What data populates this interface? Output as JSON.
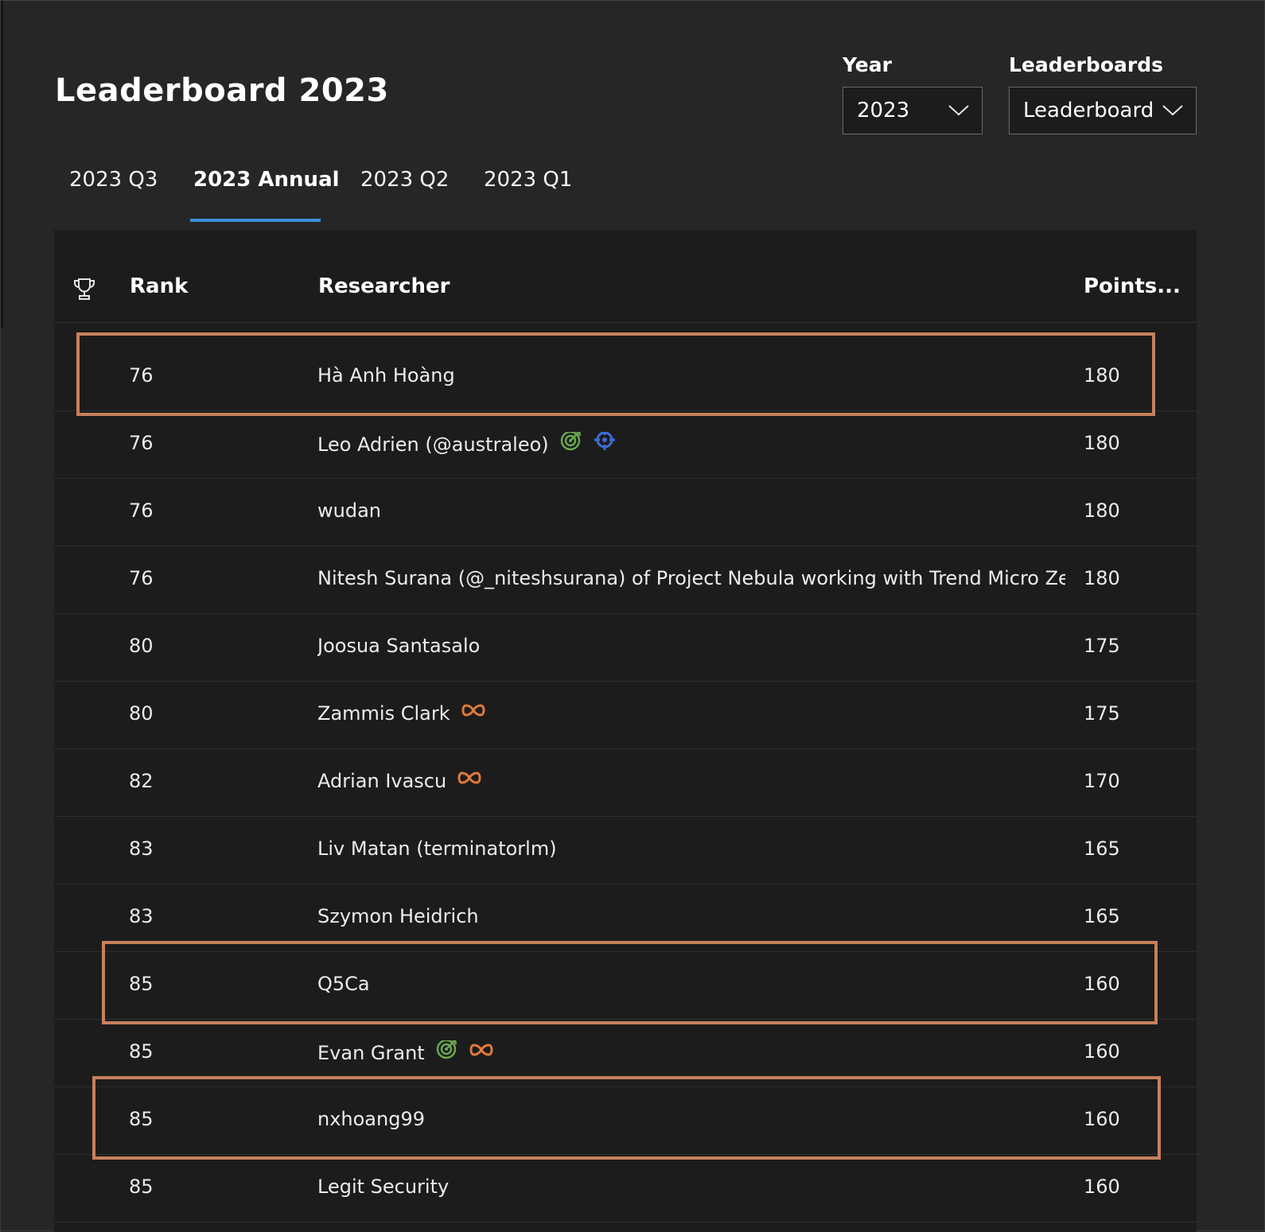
{
  "page": {
    "title": "Leaderboard 2023"
  },
  "filters": {
    "year": {
      "label": "Year",
      "value": "2023"
    },
    "leaderboards": {
      "label": "Leaderboards",
      "value": "Leaderboard"
    }
  },
  "tabs": [
    {
      "label": "2023 Q3",
      "active": false
    },
    {
      "label": "2023 Annual",
      "active": true
    },
    {
      "label": "2023 Q2",
      "active": false
    },
    {
      "label": "2023 Q1",
      "active": false
    }
  ],
  "table": {
    "headers": {
      "rank": "Rank",
      "researcher": "Researcher",
      "points": "Points..."
    },
    "rows": [
      {
        "rank": "76",
        "researcher": "Hà Anh Hoàng",
        "points": "180",
        "badges": [],
        "highlighted": true
      },
      {
        "rank": "76",
        "researcher": "Leo Adrien (@australeo)",
        "points": "180",
        "badges": [
          "target-icon",
          "crosshair-icon"
        ],
        "highlighted": false
      },
      {
        "rank": "76",
        "researcher": "wudan",
        "points": "180",
        "badges": [],
        "highlighted": false
      },
      {
        "rank": "76",
        "researcher": "Nitesh Surana (@_niteshsurana) of Project Nebula working with Trend Micro Zero Day Initi",
        "points": "180",
        "badges": [],
        "highlighted": false
      },
      {
        "rank": "80",
        "researcher": "Joosua Santasalo",
        "points": "175",
        "badges": [],
        "highlighted": false
      },
      {
        "rank": "80",
        "researcher": "Zammis Clark",
        "points": "175",
        "badges": [
          "infinity-icon"
        ],
        "highlighted": false
      },
      {
        "rank": "82",
        "researcher": "Adrian Ivascu",
        "points": "170",
        "badges": [
          "infinity-icon"
        ],
        "highlighted": false
      },
      {
        "rank": "83",
        "researcher": "Liv Matan (terminatorlm)",
        "points": "165",
        "badges": [],
        "highlighted": false
      },
      {
        "rank": "83",
        "researcher": "Szymon Heidrich",
        "points": "165",
        "badges": [],
        "highlighted": false
      },
      {
        "rank": "85",
        "researcher": "Q5Ca",
        "points": "160",
        "badges": [],
        "highlighted": true
      },
      {
        "rank": "85",
        "researcher": "Evan Grant",
        "points": "160",
        "badges": [
          "target-icon",
          "infinity-icon"
        ],
        "highlighted": false
      },
      {
        "rank": "85",
        "researcher": "nxhoang99",
        "points": "160",
        "badges": [],
        "highlighted": true
      },
      {
        "rank": "85",
        "researcher": "Legit Security",
        "points": "160",
        "badges": [],
        "highlighted": false
      }
    ]
  },
  "colors": {
    "background": "#262626",
    "table_background": "#1c1c1c",
    "tab_underline": "#3b8fdc",
    "highlight_border": "#c7805c",
    "target_badge": "#6aa84f",
    "crosshair_badge": "#3d6bd6",
    "infinity_badge": "#e07b39"
  }
}
